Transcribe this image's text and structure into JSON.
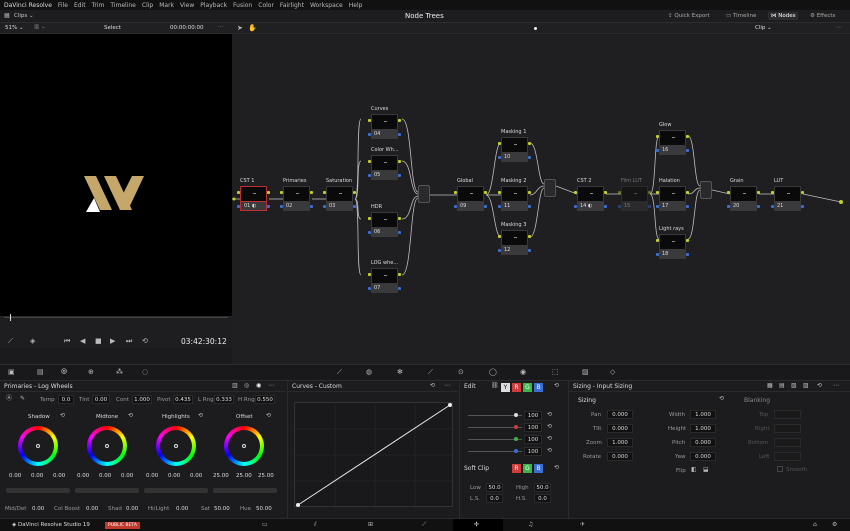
{
  "menu": {
    "app": "DaVinci Resolve",
    "items": [
      "File",
      "Edit",
      "Trim",
      "Timeline",
      "Clip",
      "Mark",
      "View",
      "Playback",
      "Fusion",
      "Color",
      "Fairlight",
      "Workspace",
      "Help"
    ]
  },
  "toolbar": {
    "clips": "Clips",
    "title": "Node Trees",
    "quick_export": "Quick Export",
    "timeline": "Timeline",
    "nodes": "Nodes",
    "effects": "Effects"
  },
  "viewer": {
    "zoom": "51%",
    "select": "Select",
    "timecode_top": "00:00:00:00",
    "timecode": "03:42:30:12"
  },
  "nodegraph": {
    "mode": "Clip"
  },
  "nodes": [
    {
      "label": "CST 1",
      "num": "01"
    },
    {
      "label": "Primaries",
      "num": "02"
    },
    {
      "label": "Saturation",
      "num": "03"
    },
    {
      "label": "Curves",
      "num": "04"
    },
    {
      "label": "Color Wh...",
      "num": "05"
    },
    {
      "label": "HDR",
      "num": "06"
    },
    {
      "label": "LOG whe...",
      "num": "07"
    },
    {
      "label": "Global",
      "num": "09"
    },
    {
      "label": "Masking 1",
      "num": "10"
    },
    {
      "label": "Masking 2",
      "num": "11"
    },
    {
      "label": "Masking 3",
      "num": "12"
    },
    {
      "label": "CST 2",
      "num": "14"
    },
    {
      "label": "Film LUT",
      "num": "15"
    },
    {
      "label": "Glow",
      "num": "16"
    },
    {
      "label": "Halation",
      "num": "17"
    },
    {
      "label": "Light rays",
      "num": "18"
    },
    {
      "label": "Grain",
      "num": "20"
    },
    {
      "label": "LUT",
      "num": "21"
    }
  ],
  "primaries": {
    "title": "Primaries - Log Wheels",
    "temp_label": "Temp",
    "temp": "0.0",
    "tint_label": "Tint",
    "tint": "0.00",
    "cont_label": "Cont",
    "cont": "1.000",
    "pivot_label": "Pivot",
    "pivot": "0.435",
    "lrng_label": "L Rng",
    "lrng": "0.333",
    "hrng_label": "H Rng",
    "hrng": "0.550",
    "wheels": [
      {
        "name": "Shadow",
        "vals": [
          "0.00",
          "0.00",
          "0.00"
        ]
      },
      {
        "name": "Midtone",
        "vals": [
          "0.00",
          "0.00",
          "0.00"
        ]
      },
      {
        "name": "Highlights",
        "vals": [
          "0.00",
          "0.00",
          "0.00"
        ]
      },
      {
        "name": "Offset",
        "vals": [
          "25.00",
          "25.00",
          "25.00"
        ]
      }
    ],
    "middet_label": "Mid/Det",
    "middet": "0.00",
    "colboost_label": "Col Boost",
    "colboost": "0.00",
    "shad_label": "Shad",
    "shad": "0.00",
    "hilight_label": "Hi/Light",
    "hilight": "0.00",
    "sat_label": "Sat",
    "sat": "50.00",
    "hue_label": "Hue",
    "hue": "50.00"
  },
  "curves": {
    "title": "Curves - Custom"
  },
  "edit": {
    "title": "Edit",
    "channels": [
      "Y",
      "R",
      "G",
      "B"
    ],
    "values": [
      "100",
      "100",
      "100",
      "100"
    ],
    "softclip": "Soft Clip",
    "low_label": "Low",
    "low": "50.0",
    "high_label": "High",
    "high": "50.0",
    "ls_label": "L.S.",
    "ls": "0.0",
    "hs_label": "H.S.",
    "hs": "0.0"
  },
  "sizing": {
    "title": "Sizing - Input Sizing",
    "section": "Sizing",
    "blanking": "Blanking",
    "pan_label": "Pan",
    "pan": "0.000",
    "tilt_label": "Tilt",
    "tilt": "0.000",
    "zoom_label": "Zoom",
    "zoom": "1.000",
    "rotate_label": "Rotate",
    "rotate": "0.000",
    "width_label": "Width",
    "width": "1.000",
    "height_label": "Height",
    "height": "1.000",
    "pitch_label": "Pitch",
    "pitch": "0.000",
    "yaw_label": "Yaw",
    "yaw": "0.000",
    "flip_label": "Flip",
    "top": "Top",
    "right": "Right",
    "bottom": "Bottom",
    "left": "Left",
    "smooth": "Smooth"
  },
  "status": {
    "app": "DaVinci Resolve Studio 19",
    "badge": "PUBLIC BETA"
  },
  "colors": {
    "accent": "#c6a76a",
    "red": "#d23b3b",
    "green": "#3bb44a",
    "blue": "#3a6fd8",
    "yellow": "#c6cf1f"
  }
}
